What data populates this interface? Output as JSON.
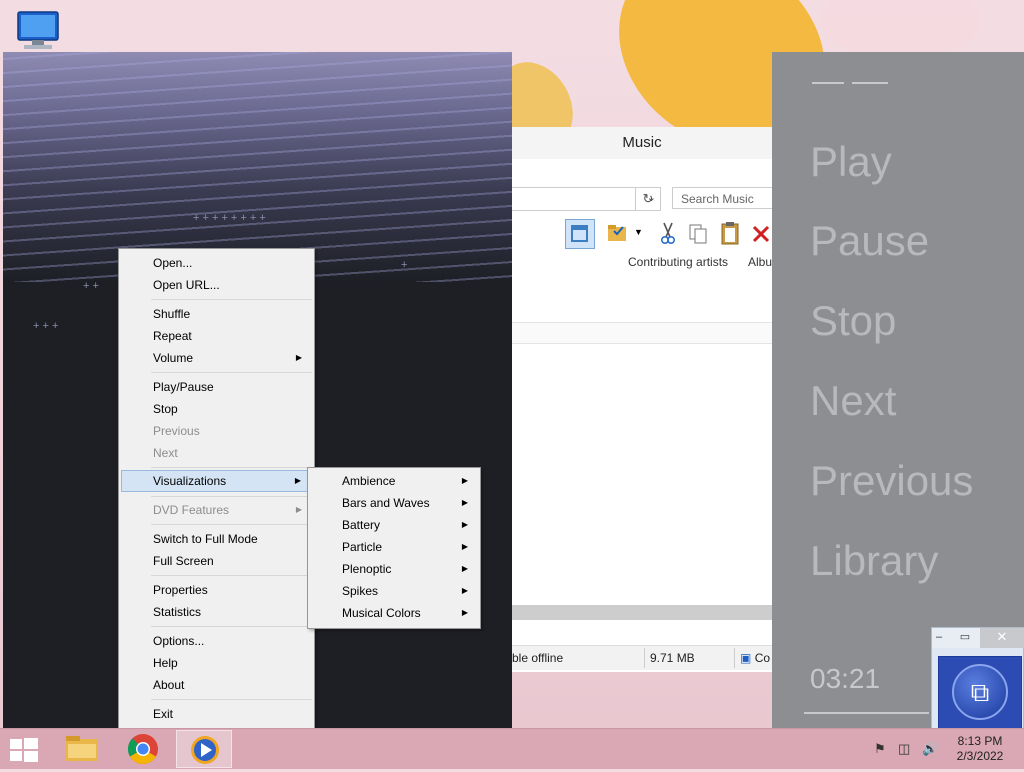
{
  "desktop": {
    "icon_name": "computer-icon"
  },
  "explorer": {
    "title": "Music",
    "search_placeholder": "Search Music",
    "columns": [
      "Contributing artists",
      "Albu"
    ],
    "status_left": "ble offline",
    "status_size": "9.71 MB",
    "status_right": "Co"
  },
  "context_menu": {
    "items": [
      {
        "label": "Open...",
        "disabled": false
      },
      {
        "label": "Open URL...",
        "disabled": false
      },
      {
        "label": "Shuffle",
        "disabled": false
      },
      {
        "label": "Repeat",
        "disabled": false
      },
      {
        "label": "Volume",
        "disabled": false,
        "submenu": true
      },
      {
        "label": "Play/Pause",
        "disabled": false
      },
      {
        "label": "Stop",
        "disabled": false
      },
      {
        "label": "Previous",
        "disabled": true
      },
      {
        "label": "Next",
        "disabled": true
      },
      {
        "label": "Visualizations",
        "disabled": false,
        "submenu": true,
        "highlighted": true
      },
      {
        "label": "DVD Features",
        "disabled": true,
        "submenu": true
      },
      {
        "label": "Switch to Full Mode",
        "disabled": false
      },
      {
        "label": "Full Screen",
        "disabled": false
      },
      {
        "label": "Properties",
        "disabled": false
      },
      {
        "label": "Statistics",
        "disabled": false
      },
      {
        "label": "Options...",
        "disabled": false
      },
      {
        "label": "Help",
        "disabled": false
      },
      {
        "label": "About",
        "disabled": false
      },
      {
        "label": "Exit",
        "disabled": false
      }
    ]
  },
  "visualizations_menu": {
    "items": [
      "Ambience",
      "Bars and Waves",
      "Battery",
      "Particle",
      "Plenoptic",
      "Spikes",
      "Musical Colors"
    ]
  },
  "side_panel": {
    "items": [
      "Play",
      "Pause",
      "Stop",
      "Next",
      "Previous",
      "Library"
    ],
    "time": "03:21"
  },
  "mini_player": {
    "close_label": "✕",
    "minimize_label": "–",
    "restore_label": "▭"
  },
  "taskbar": {
    "time": "8:13 PM",
    "date": "2/3/2022"
  }
}
